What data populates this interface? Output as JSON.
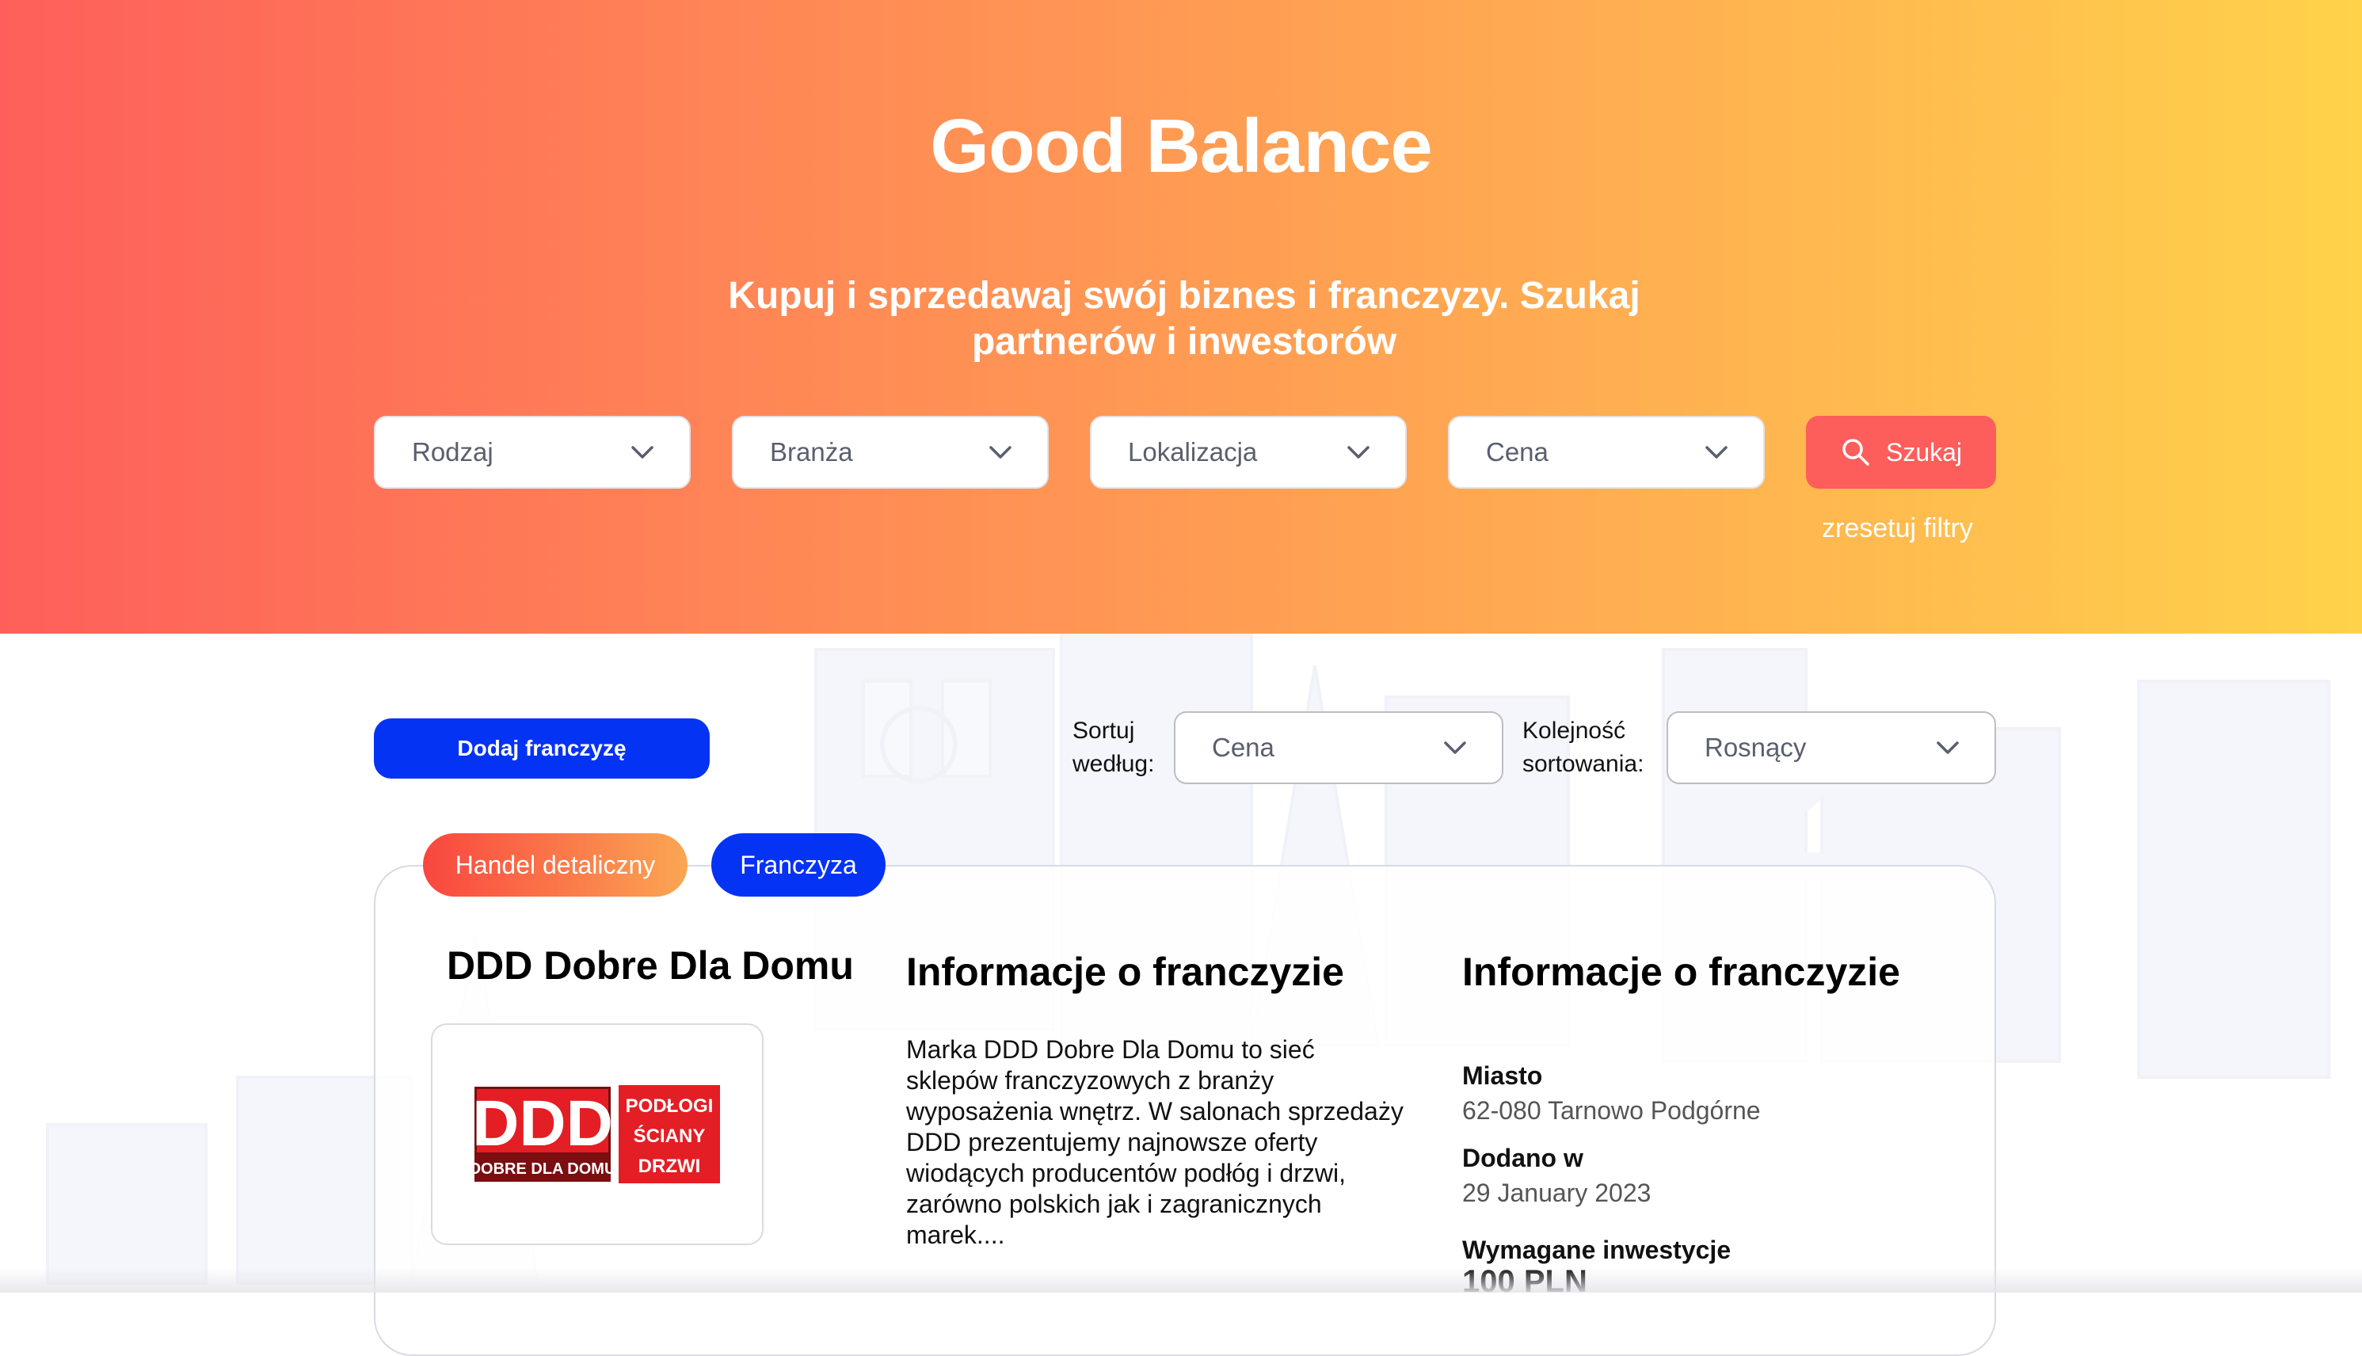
{
  "hero": {
    "title": "Good Balance",
    "subtitle": "Kupuj i sprzedawaj swój biznes i franczyzy. Szukaj partnerów i inwestorów"
  },
  "filters": {
    "type": "Rodzaj",
    "industry": "Branża",
    "location": "Lokalizacja",
    "price": "Cena",
    "search_label": "Szukaj",
    "reset_label": "zresetuj filtry"
  },
  "toolbar": {
    "add_label": "Dodaj franczyzę",
    "sort_by_label_line1": "Sortuj",
    "sort_by_label_line2": "według:",
    "sort_by_value": "Cena",
    "order_label_line1": "Kolejność",
    "order_label_line2": "sortowania:",
    "order_value": "Rosnący"
  },
  "listing": {
    "tags": [
      "Handel detaliczny",
      "Franczyza"
    ],
    "name": "DDD Dobre Dla Domu",
    "logo": {
      "main": "DDD",
      "sub": "DOBRE DLA DOMU",
      "right": [
        "PODŁOGI",
        "ŚCIANY",
        "DRZWI"
      ]
    },
    "description_title": "Informacje o franczyzie",
    "description": "Marka DDD Dobre Dla Domu to sieć sklepów franczyzowych z branży wyposażenia wnętrz. W salonach sprzedaży DDD prezentujemy najnowsze oferty wiodących producentów podłóg i drzwi, zarówno polskich jak i zagranicznych marek....",
    "info_title": "Informacje o franczyzie",
    "city_label": "Miasto",
    "city_value": "62-080 Tarnowo Podgórne",
    "added_label": "Dodano w",
    "added_value": "29 January 2023",
    "investment_label": "Wymagane inwestycje",
    "investment_value": "100 PLN"
  },
  "colors": {
    "accent_blue": "#0533f4",
    "search_red": "#fd5d5b",
    "logo_red": "#e31e24"
  }
}
